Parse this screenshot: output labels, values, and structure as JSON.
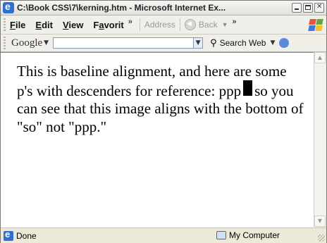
{
  "window": {
    "title": "C:\\Book CSS\\7\\kerning.htm - Microsoft Internet Ex",
    "title_suffix": "..."
  },
  "menubar": {
    "items": [
      {
        "label": "File"
      },
      {
        "label": "Edit"
      },
      {
        "label": "View"
      },
      {
        "label": "Favorit"
      }
    ],
    "overflow": "»",
    "address_label": "Address",
    "back_label": "Back",
    "overflow2": "»"
  },
  "google_toolbar": {
    "logo": "Google",
    "search_value": "",
    "search_web_label": "Search Web"
  },
  "content": {
    "text_before": "This is baseline alignment, and here are some p's with descenders for reference: ppp",
    "text_after": "so you can see that this image aligns with the bottom of \"so\" not \"ppp.\""
  },
  "statusbar": {
    "status": "Done",
    "zone": "My Computer"
  }
}
